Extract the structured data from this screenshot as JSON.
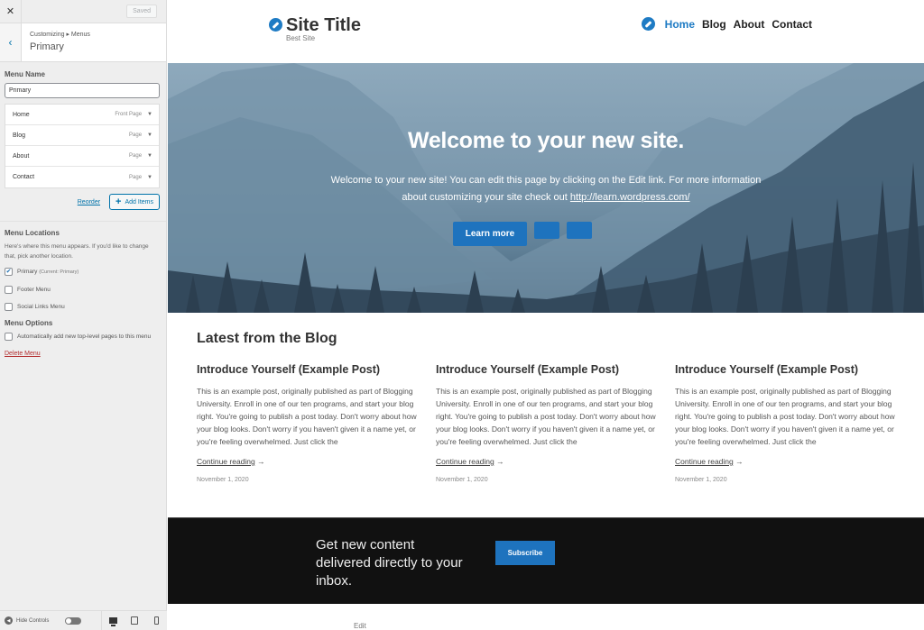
{
  "sidebar": {
    "close_icon": "close-icon",
    "saved_label": "Saved",
    "breadcrumb": "Customizing ▸ Menus",
    "panel_title": "Primary",
    "menu_name_label": "Menu Name",
    "menu_name_value": "Primary",
    "menu_items": [
      {
        "title": "Home",
        "type": "Front Page"
      },
      {
        "title": "Blog",
        "type": "Page"
      },
      {
        "title": "About",
        "type": "Page"
      },
      {
        "title": "Contact",
        "type": "Page"
      }
    ],
    "reorder_label": "Reorder",
    "add_items_label": "Add Items",
    "locations_heading": "Menu Locations",
    "locations_desc": "Here's where this menu appears. If you'd like to change that, pick another location.",
    "locations": [
      {
        "label": "Primary",
        "note": "(Current: Primary)",
        "checked": true
      },
      {
        "label": "Footer Menu",
        "note": "",
        "checked": false
      },
      {
        "label": "Social Links Menu",
        "note": "",
        "checked": false
      }
    ],
    "options_heading": "Menu Options",
    "auto_add_label": "Automatically add new top-level pages to this menu",
    "auto_add_checked": false,
    "delete_label": "Delete Menu",
    "hide_controls_label": "Hide Controls",
    "devices": [
      "desktop",
      "tablet",
      "mobile"
    ]
  },
  "site": {
    "title": "Site Title",
    "tagline": "Best Site",
    "nav": [
      {
        "label": "Home",
        "active": true
      },
      {
        "label": "Blog",
        "active": false
      },
      {
        "label": "About",
        "active": false
      },
      {
        "label": "Contact",
        "active": false
      }
    ],
    "accent_color": "#1e73be"
  },
  "hero": {
    "title": "Welcome to your new site.",
    "text": "Welcome to your new site! You can edit this page by clicking on the Edit link. For more information about customizing your site check out",
    "link": "http://learn.wordpress.com/",
    "button_label": "Learn more"
  },
  "blog": {
    "heading": "Latest from the Blog",
    "posts": [
      {
        "title": "Introduce Yourself (Example Post)",
        "excerpt": "This is an example post, originally published as part of Blogging University. Enroll in one of our ten programs, and start your blog right. You're going to publish a post today. Don't worry about how your blog looks. Don't worry if you haven't given it a name yet, or you're feeling overwhelmed. Just click the",
        "more": "Continue reading",
        "date": "November 1, 2020"
      },
      {
        "title": "Introduce Yourself (Example Post)",
        "excerpt": "This is an example post, originally published as part of Blogging University. Enroll in one of our ten programs, and start your blog right. You're going to publish a post today. Don't worry about how your blog looks. Don't worry if you haven't given it a name yet, or you're feeling overwhelmed. Just click the",
        "more": "Continue reading",
        "date": "November 1, 2020"
      },
      {
        "title": "Introduce Yourself (Example Post)",
        "excerpt": "This is an example post, originally published as part of Blogging University. Enroll in one of our ten programs, and start your blog right. You're going to publish a post today. Don't worry about how your blog looks. Don't worry if you haven't given it a name yet, or you're feeling overwhelmed. Just click the",
        "more": "Continue reading",
        "date": "November 1, 2020"
      }
    ]
  },
  "subscribe": {
    "text": "Get new content delivered directly to your inbox.",
    "button_label": "Subscribe"
  },
  "footer": {
    "edit_label": "Edit"
  }
}
